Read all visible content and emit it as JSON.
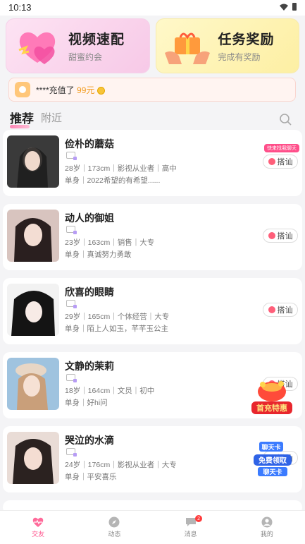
{
  "status_bar": {
    "time": "10:13"
  },
  "banners": [
    {
      "title": "视频速配",
      "subtitle": "甜蜜约会"
    },
    {
      "title": "任务奖励",
      "subtitle": "完成有奖励"
    }
  ],
  "ticker": {
    "user": "****充值了",
    "amount": "99元"
  },
  "tabs": [
    {
      "label": "推荐",
      "active": true
    },
    {
      "label": "附近",
      "active": false
    }
  ],
  "profiles": [
    {
      "name": "俭朴的蘑菇",
      "line1": "28岁｜173cm｜影视从业者｜高中",
      "line2": "单身｜2022希望的有希望......",
      "greet": "搭讪",
      "tag": "快来找我聊天"
    },
    {
      "name": "动人的御姐",
      "line1": "23岁｜163cm｜销售｜大专",
      "line2": "单身｜真诚努力勇敢",
      "greet": "搭讪"
    },
    {
      "name": "欣喜的眼睛",
      "line1": "29岁｜165cm｜个体经营｜大专",
      "line2": "单身｜陌上人如玉，芊芊玉公主",
      "greet": "搭讪"
    },
    {
      "name": "文静的茉莉",
      "line1": "18岁｜164cm｜文员｜初中",
      "line2": "单身｜好hi问",
      "greet": "搭讪"
    },
    {
      "name": "哭泣的水滴",
      "line1": "24岁｜176cm｜影视从业者｜大专",
      "line2": "单身｜平安喜乐",
      "greet": "搭讪"
    }
  ],
  "promos": {
    "first_charge": "首充特惠",
    "chat_card": "聊天卡",
    "free_get": "免费领取",
    "chat_card2": "聊天卡"
  },
  "nav": [
    {
      "label": "交友",
      "active": true,
      "icon": "heart-pulse-icon"
    },
    {
      "label": "动态",
      "active": false,
      "icon": "compass-icon"
    },
    {
      "label": "消息",
      "active": false,
      "icon": "chat-icon",
      "badge": "2"
    },
    {
      "label": "我的",
      "active": false,
      "icon": "user-icon"
    }
  ],
  "colors": {
    "accent": "#ff4f8a",
    "ticker_amount": "#f29b1e"
  }
}
